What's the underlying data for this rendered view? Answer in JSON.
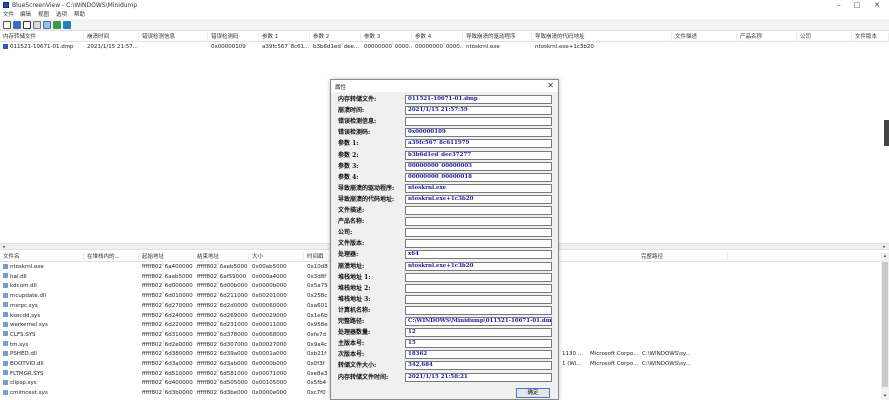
{
  "window": {
    "title": "BlueScreenView  -  C:\\WINDOWS\\Minidump",
    "controls": [
      "–",
      "□",
      "✕"
    ]
  },
  "menu": [
    "文件",
    "编辑",
    "视图",
    "选项",
    "帮助"
  ],
  "toolbar_icons": [
    "new-icon",
    "save-icon",
    "properties-icon",
    "copy-icon",
    "html-report-icon",
    "refresh-icon",
    "about-icon"
  ],
  "upper_list": {
    "columns": [
      "内存转储文件",
      "崩溃时间",
      "错误检测信息",
      "错误检测码",
      "参数 1",
      "参数 2",
      "参数 3",
      "参数 4",
      "导致崩溃的驱动程序",
      "导致崩溃的代码地址",
      "文件描述",
      "产品名称",
      "公司",
      "文件版本"
    ],
    "rows": [
      [
        "011521-10671-01.dmp",
        "2021/1/15 21:57...",
        "",
        "0x00000109",
        "a39fc567`8c61...",
        "b3b6d1ed`dee...",
        "00000000`0000...",
        "00000000`0000...",
        "ntoskrnl.exe",
        "ntoskrnl.exe+1c3b20",
        "",
        "",
        "",
        ""
      ]
    ]
  },
  "lower_list": {
    "columns_left": [
      "文件名",
      "在堆栈内的...",
      "起始地址",
      "结束地址",
      "大小",
      "时间戳"
    ],
    "columns_right": [
      "完整路径"
    ],
    "rows": [
      {
        "name": "ntoskrnl.exe",
        "start": "fffff802`6a400000",
        "end": "fffff802`6aeb5000",
        "size": "0x00ab5000",
        "ts": "0x10d8",
        "ver": "",
        "company": "",
        "path": ""
      },
      {
        "name": "hal.dll",
        "start": "fffff802`6aeb5000",
        "end": "fffff802`6af59000",
        "size": "0x000a4000",
        "ts": "0x3d8f",
        "ver": "",
        "company": "",
        "path": ""
      },
      {
        "name": "kdcom.dll",
        "start": "fffff802`6d000000",
        "end": "fffff802`6d00b000",
        "size": "0x0000b000",
        "ts": "0x5a75",
        "ver": "",
        "company": "",
        "path": ""
      },
      {
        "name": "mcupdate.dll",
        "start": "fffff802`6d010000",
        "end": "fffff802`6d211000",
        "size": "0x00201000",
        "ts": "0x258c",
        "ver": "",
        "company": "",
        "path": ""
      },
      {
        "name": "msrpc.sys",
        "start": "fffff802`6d270000",
        "end": "fffff802`6d2d0000",
        "size": "0x00060000",
        "ts": "0xa601",
        "ver": "",
        "company": "",
        "path": ""
      },
      {
        "name": "ksecdd.sys",
        "start": "fffff802`6d240000",
        "end": "fffff802`6d269000",
        "size": "0x00029000",
        "ts": "0x1e6b",
        "ver": "",
        "company": "",
        "path": ""
      },
      {
        "name": "werkernel.sys",
        "start": "fffff802`6d220000",
        "end": "fffff802`6d231000",
        "size": "0x00011000",
        "ts": "0x958e",
        "ver": "",
        "company": "",
        "path": ""
      },
      {
        "name": "CLFS.SYS",
        "start": "fffff802`6d310000",
        "end": "fffff802`6d378000",
        "size": "0x00068000",
        "ts": "0xfe7d",
        "ver": "",
        "company": "",
        "path": ""
      },
      {
        "name": "tm.sys",
        "start": "fffff802`6d2e0000",
        "end": "fffff802`6d307000",
        "size": "0x00027000",
        "ts": "0x9a4c",
        "ver": "",
        "company": "",
        "path": ""
      },
      {
        "name": "PSHED.dll",
        "start": "fffff802`6d380000",
        "end": "fffff802`6d39a000",
        "size": "0x0001a000",
        "ts": "0xb21f",
        "ver": "1130 ...",
        "company": "Microsoft Corpo...",
        "path": "C:\\WINDOWS\\sy..."
      },
      {
        "name": "BOOTVID.dll",
        "start": "fffff802`6d3a0000",
        "end": "fffff802`6d3ab000",
        "size": "0x0000b000",
        "ts": "0x0f3f",
        "ver": "1 (Wi...",
        "company": "Microsoft Corpo...",
        "path": "C:\\WINDOWS\\sy..."
      },
      {
        "name": "FLTMGR.SYS",
        "start": "fffff802`6d510000",
        "end": "fffff802`6d581000",
        "size": "0x00071000",
        "ts": "0xe8a3",
        "ver": "",
        "company": "",
        "path": ""
      },
      {
        "name": "clipsp.sys",
        "start": "fffff802`6d400000",
        "end": "fffff802`6d505000",
        "size": "0x00105000",
        "ts": "0x5fb4",
        "ver": "",
        "company": "",
        "path": ""
      },
      {
        "name": "cmimcext.sys",
        "start": "fffff802`6d3b0000",
        "end": "fffff802`6d3be000",
        "size": "0x0000e000",
        "ts": "0xc7f0",
        "ver": "",
        "company": "",
        "path": ""
      }
    ]
  },
  "dialog": {
    "title": "属性",
    "close": "✕",
    "ok_label": "确定",
    "fields": [
      {
        "label": "内存转储文件:",
        "value": "011521-10671-01.dmp"
      },
      {
        "label": "崩溃时间:",
        "value": "2021/1/15 21:57:59"
      },
      {
        "label": "错误检测信息:",
        "value": ""
      },
      {
        "label": "错误检测码:",
        "value": "0x00000109"
      },
      {
        "label": "参数 1:",
        "value": "a39fc567`8c611979"
      },
      {
        "label": "参数 2:",
        "value": "b3b6d1ed`dee37277"
      },
      {
        "label": "参数 3:",
        "value": "00000000`00000003"
      },
      {
        "label": "参数 4:",
        "value": "00000000`00000018"
      },
      {
        "label": "导致崩溃的驱动程序:",
        "value": "ntoskrnl.exe"
      },
      {
        "label": "导致崩溃的代码地址:",
        "value": "ntoskrnl.exe+1c3b20"
      },
      {
        "label": "文件描述:",
        "value": ""
      },
      {
        "label": "产品名称:",
        "value": ""
      },
      {
        "label": "公司:",
        "value": ""
      },
      {
        "label": "文件版本:",
        "value": ""
      },
      {
        "label": "处理器:",
        "value": "x64"
      },
      {
        "label": "崩溃地址:",
        "value": "ntoskrnl.exe+1c3b20"
      },
      {
        "label": "堆栈地址 1:",
        "value": ""
      },
      {
        "label": "堆栈地址 2:",
        "value": ""
      },
      {
        "label": "堆栈地址 3:",
        "value": ""
      },
      {
        "label": "计算机名称:",
        "value": ""
      },
      {
        "label": "完整路径:",
        "value": "C:\\WINDOWS\\Minidump\\011521-10671-01.dmp"
      },
      {
        "label": "处理器数量:",
        "value": "12"
      },
      {
        "label": "主版本号:",
        "value": "15"
      },
      {
        "label": "次版本号:",
        "value": "18362"
      },
      {
        "label": "转储文件大小:",
        "value": "342,684"
      },
      {
        "label": "内存转储文件时间:",
        "value": "2021/1/15 21:58:21"
      }
    ]
  },
  "colors": {
    "value_text": "#1a1aa0",
    "selection": "#2a5db0",
    "ok_border": "#3c7fd0"
  }
}
